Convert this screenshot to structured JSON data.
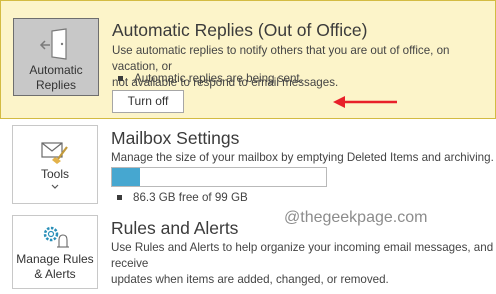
{
  "accent_color": "#46a7d0",
  "arrow_color": "#e8202a",
  "auto_replies": {
    "tile_label_1": "Automatic",
    "tile_label_2": "Replies",
    "tile_icon": "door-exit-arrow-icon",
    "title": "Automatic Replies (Out of Office)",
    "description_1": "Use automatic replies to notify others that you are out of office, on vacation, or",
    "description_2": "not available to respond to email messages.",
    "status": "Automatic replies are being sent.",
    "turn_off_label": "Turn off"
  },
  "mailbox": {
    "tile_label": "Tools",
    "tile_icon": "envelope-broom-icon",
    "chevron_icon": "chevron-down-icon",
    "title": "Mailbox Settings",
    "description": "Manage the size of your mailbox by emptying Deleted Items and archiving.",
    "storage_fraction": 0.13,
    "storage_text": "86.3 GB free of 99 GB"
  },
  "rules": {
    "tile_label_1": "Manage Rules",
    "tile_label_2": "& Alerts",
    "tile_icon": "gear-bell-icon",
    "title": "Rules and Alerts",
    "description_1": "Use Rules and Alerts to help organize your incoming email messages, and receive",
    "description_2": "updates when items are added, changed, or removed."
  },
  "watermark": "@thegeekpage.com"
}
